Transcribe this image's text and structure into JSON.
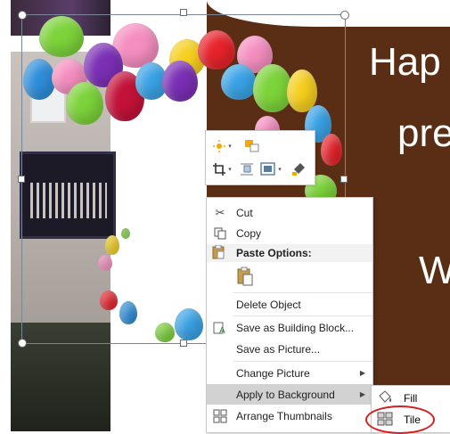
{
  "slide": {
    "text_line1": "Hap",
    "text_line2": "pre",
    "text_line3": "W"
  },
  "mini_toolbar": {
    "buttons": [
      "sun-effects-icon",
      "bring-forward-icon",
      "crop-icon",
      "wrap-text-icon",
      "picture-styles-icon",
      "format-painter-icon"
    ]
  },
  "context_menu": {
    "cut": "Cut",
    "copy": "Copy",
    "paste_options": "Paste Options:",
    "delete_object": "Delete Object",
    "save_building_block": "Save as Building Block...",
    "save_picture": "Save as Picture...",
    "change_picture": "Change Picture",
    "apply_background": "Apply to Background",
    "arrange_thumbnails": "Arrange Thumbnails"
  },
  "submenu": {
    "fill": "Fill",
    "tile": "Tile"
  },
  "colors": {
    "slide_brown": "#5a2e14",
    "menu_highlight": "#d2d2d2",
    "annotation_red": "#d21f1f"
  }
}
